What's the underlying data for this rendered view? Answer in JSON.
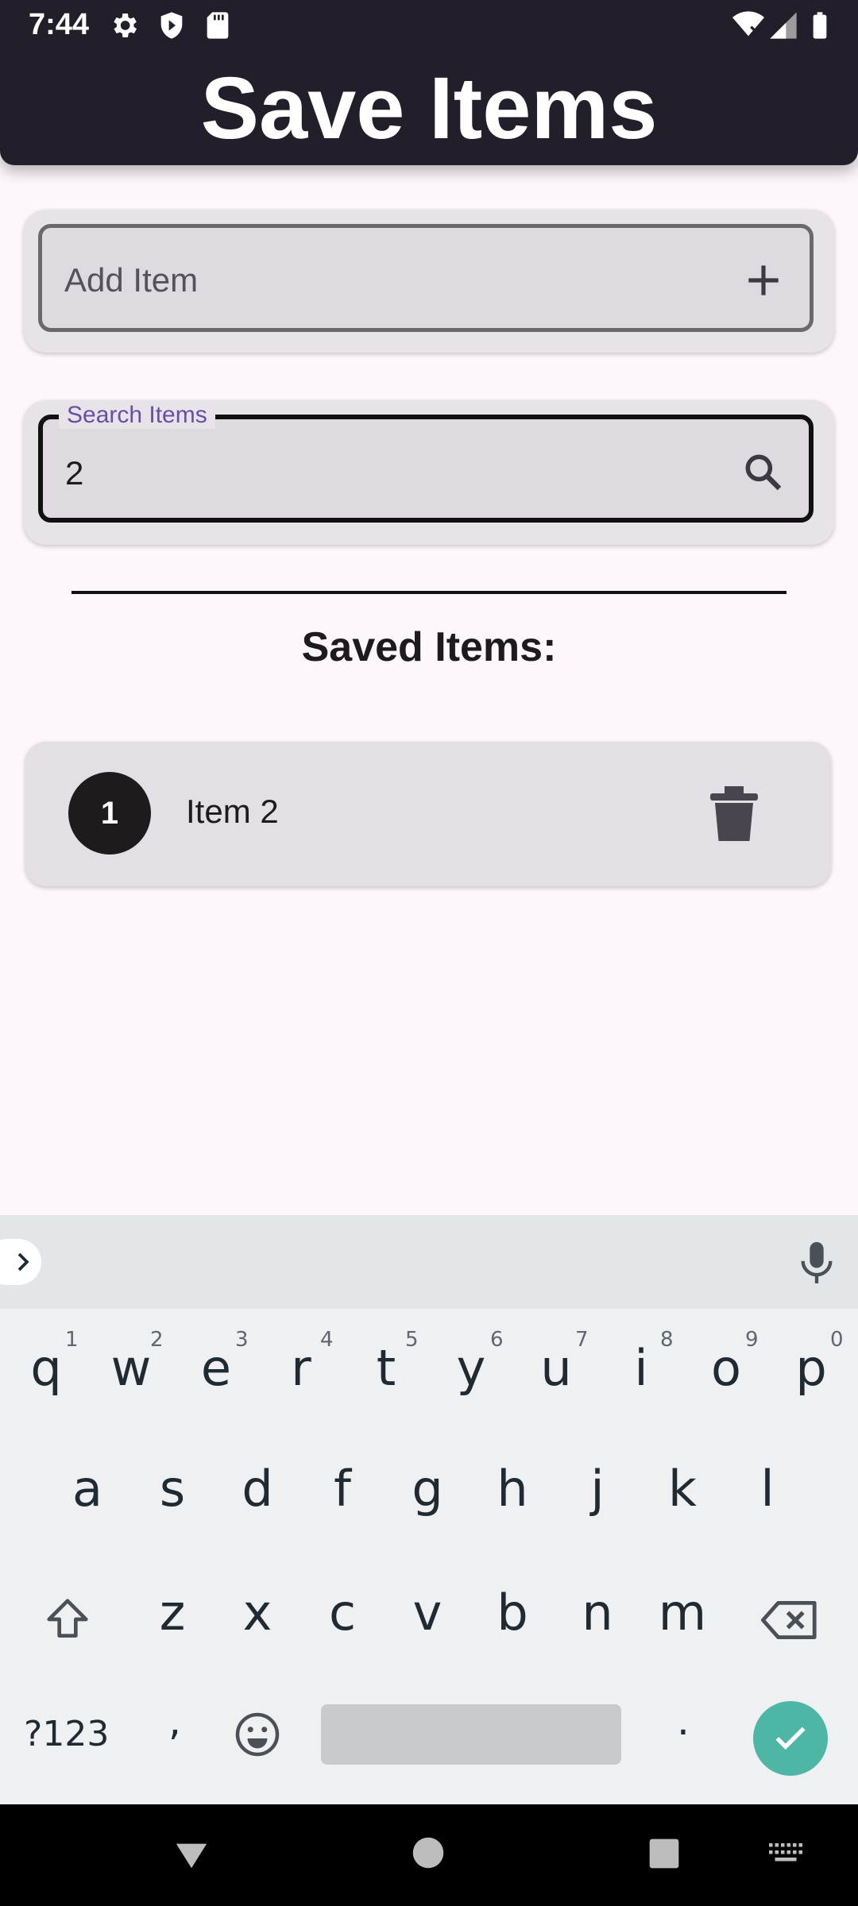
{
  "status_bar": {
    "time": "7:44",
    "icons": [
      "settings-icon",
      "shield-play-icon",
      "sd-card-icon",
      "wifi-x-icon",
      "signal-icon",
      "battery-icon"
    ]
  },
  "app_bar": {
    "title": "Save Items"
  },
  "add_item": {
    "placeholder": "Add Item",
    "icon": "plus-icon"
  },
  "search": {
    "label": "Search Items",
    "value": "2",
    "icon": "search-icon"
  },
  "saved": {
    "title": "Saved Items:",
    "items": [
      {
        "number": "1",
        "label": "Item 2",
        "icon": "trash-icon"
      }
    ]
  },
  "keyboard": {
    "row1": [
      "q",
      "w",
      "e",
      "r",
      "t",
      "y",
      "u",
      "i",
      "o",
      "p"
    ],
    "row1_hints": [
      "1",
      "2",
      "3",
      "4",
      "5",
      "6",
      "7",
      "8",
      "9",
      "0"
    ],
    "row2": [
      "a",
      "s",
      "d",
      "f",
      "g",
      "h",
      "j",
      "k",
      "l"
    ],
    "row3": [
      "z",
      "x",
      "c",
      "v",
      "b",
      "n",
      "m"
    ],
    "symbols_label": "?123",
    "comma": ",",
    "period": "."
  },
  "colors": {
    "app_bar": "#221f2b",
    "background": "#fdf7fc",
    "accent_label": "#6750a4",
    "enter_key": "#4db6a5"
  }
}
